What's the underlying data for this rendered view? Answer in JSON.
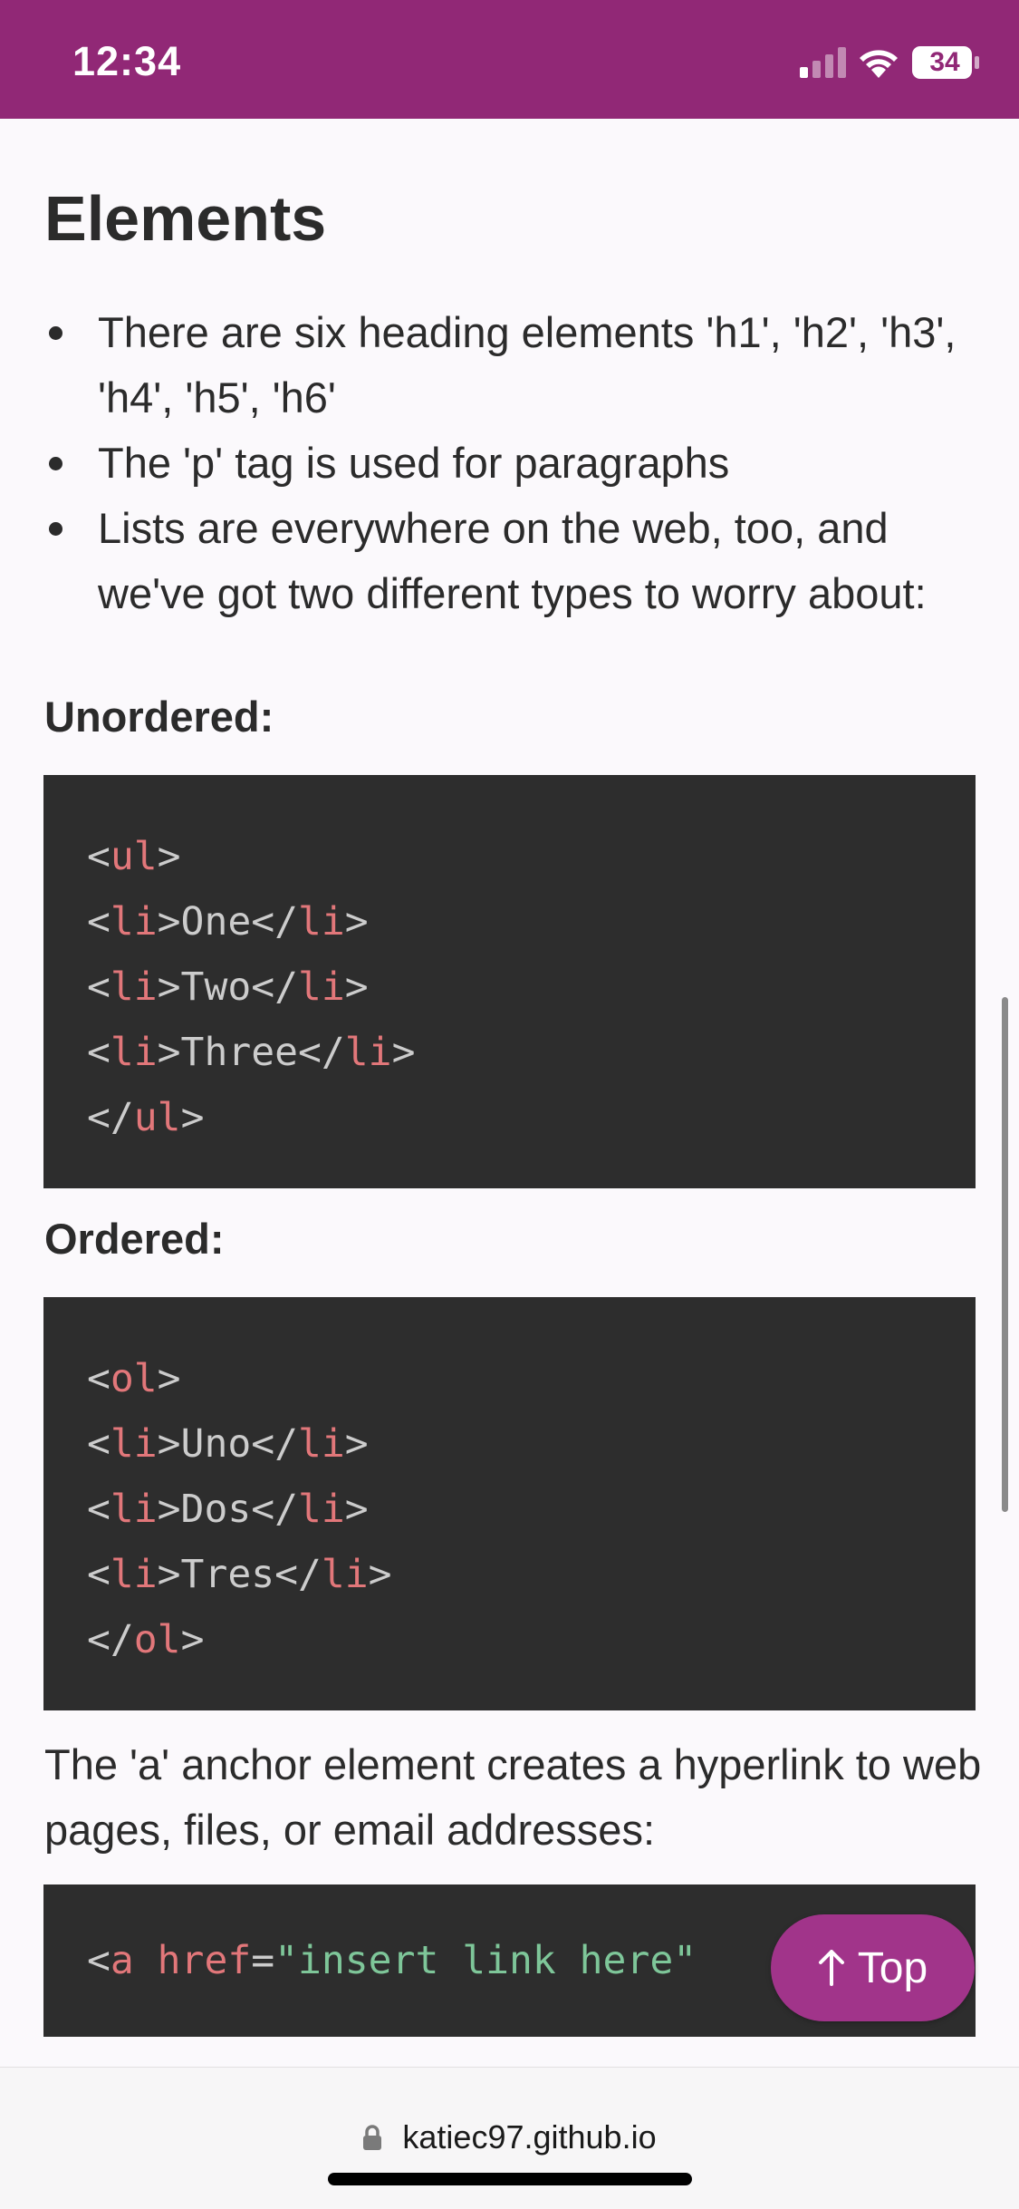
{
  "status_bar": {
    "time": "12:34",
    "battery": "34",
    "background": "#912876"
  },
  "content": {
    "heading": "Elements",
    "bullets": [
      "There are six heading elements 'h1', 'h2', 'h3', 'h4', 'h5', 'h6'",
      "The 'p' tag is used for paragraphs",
      "Lists are everywhere on the web, too, and we've got two different types to worry about:"
    ],
    "unordered_label": "Unordered:",
    "unordered_code": [
      {
        "open": "<",
        "tag": "ul",
        "close": ">"
      },
      {
        "open": "<",
        "tag": "li",
        "mid": ">One</",
        "tag2": "li",
        "close": ">"
      },
      {
        "open": "<",
        "tag": "li",
        "mid": ">Two</",
        "tag2": "li",
        "close": ">"
      },
      {
        "open": "<",
        "tag": "li",
        "mid": ">Three</",
        "tag2": "li",
        "close": ">"
      },
      {
        "open": "</",
        "tag": "ul",
        "close": ">"
      }
    ],
    "ordered_label": "Ordered:",
    "ordered_code": [
      {
        "open": "<",
        "tag": "ol",
        "close": ">"
      },
      {
        "open": "<",
        "tag": "li",
        "mid": ">Uno</",
        "tag2": "li",
        "close": ">"
      },
      {
        "open": "<",
        "tag": "li",
        "mid": ">Dos</",
        "tag2": "li",
        "close": ">"
      },
      {
        "open": "<",
        "tag": "li",
        "mid": ">Tres</",
        "tag2": "li",
        "close": ">"
      },
      {
        "open": "</",
        "tag": "ol",
        "close": ">"
      }
    ],
    "anchor_paragraph": "The 'a' anchor element creates a hyperlink to web pages, files, or email addresses:",
    "anchor_code": {
      "open": "<",
      "tag": "a",
      "attr": "href",
      "eq": "=",
      "value": "\"insert link here\""
    }
  },
  "top_button": {
    "label": "Top",
    "icon": "arrow-up-icon",
    "color": "#a1348a"
  },
  "browser": {
    "url": "katiec97.github.io",
    "icon": "lock-icon"
  },
  "colors": {
    "code_bg": "#2d2d2d",
    "code_tag": "#e2777a",
    "code_string": "#7ec699",
    "code_text": "#cccccc"
  }
}
